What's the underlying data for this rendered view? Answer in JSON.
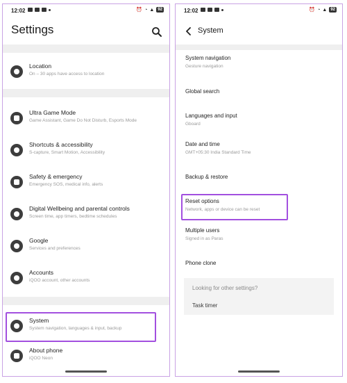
{
  "left": {
    "status": {
      "time": "12:02",
      "battery": "92"
    },
    "header": {
      "title": "Settings"
    },
    "groups": [
      [
        {
          "label": "Location",
          "sub": "On – 30 apps have access to location",
          "icon": "location-icon"
        }
      ],
      [
        {
          "label": "Ultra Game Mode",
          "sub": "Game Assistant, Game Do Not Disturb, Esports Mode",
          "icon": "gamepad-icon"
        },
        {
          "label": "Shortcuts & accessibility",
          "sub": "S-capture, Smart Motion, Accessibility",
          "icon": "accessibility-icon"
        },
        {
          "label": "Safety & emergency",
          "sub": "Emergency SOS, medical info, alerts",
          "icon": "emergency-icon"
        },
        {
          "label": "Digital Wellbeing and parental controls",
          "sub": "Screen time, app timers, bedtime schedules",
          "icon": "wellbeing-icon"
        },
        {
          "label": "Google",
          "sub": "Services and preferences",
          "icon": "google-icon"
        },
        {
          "label": "Accounts",
          "sub": "iQOO account, other accounts",
          "icon": "key-icon"
        }
      ],
      [
        {
          "label": "System",
          "sub": "System navigation, languages & input, backup",
          "icon": "system-gear-icon"
        },
        {
          "label": "About phone",
          "sub": "iQOO Neon",
          "icon": "phone-icon"
        }
      ]
    ]
  },
  "right": {
    "status": {
      "time": "12:02",
      "battery": "92"
    },
    "header": {
      "title": "System"
    },
    "items": [
      {
        "label": "System navigation",
        "sub": "Gesture navigation"
      },
      {
        "label": "Global search",
        "sub": ""
      },
      {
        "label": "Languages and input",
        "sub": "Gboard"
      },
      {
        "label": "Date and time",
        "sub": "GMT+05:30 India Standard Time"
      },
      {
        "label": "Backup & restore",
        "sub": ""
      },
      {
        "label": "Reset options",
        "sub": "Network, apps or device can be reset"
      },
      {
        "label": "Multiple users",
        "sub": "Signed in as Paras"
      },
      {
        "label": "Phone clone",
        "sub": ""
      }
    ],
    "other": {
      "question": "Looking for other settings?",
      "link": "Task timer"
    }
  },
  "colors": {
    "highlight": "#a24fdf",
    "icon": "#3d3d3d",
    "divider": "#efefef"
  }
}
